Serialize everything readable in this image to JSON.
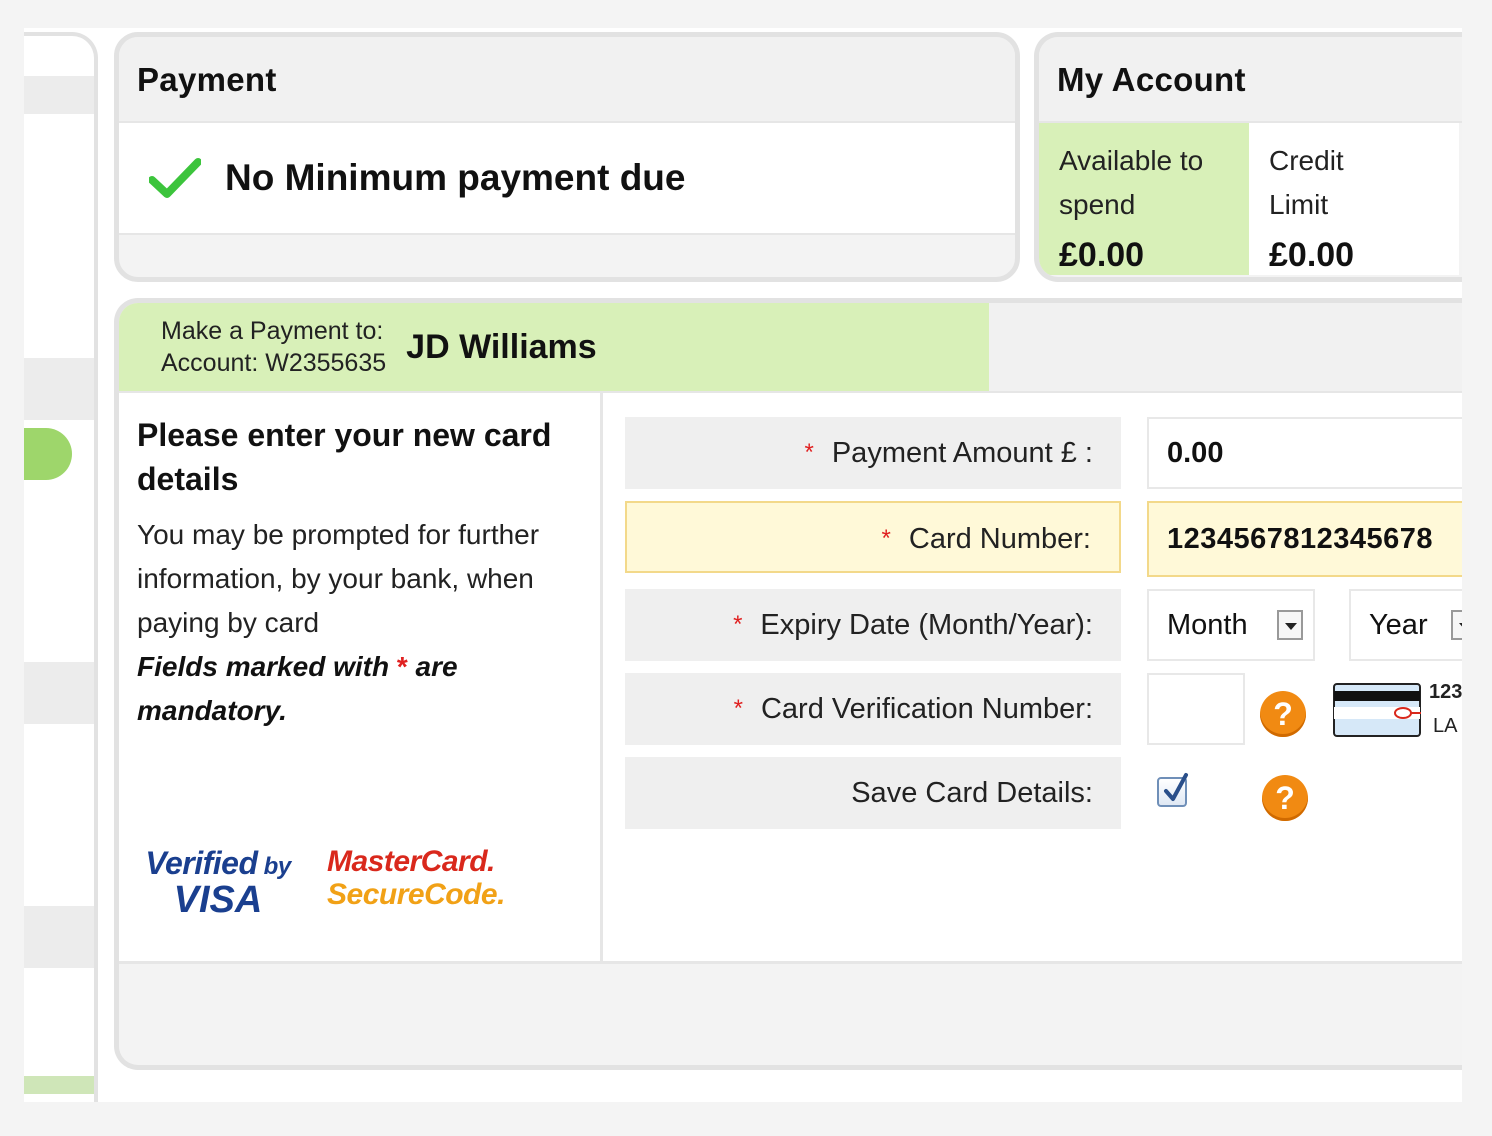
{
  "payment": {
    "title": "Payment",
    "status": "No Minimum payment due"
  },
  "account": {
    "title": "My Account",
    "available_label": "Available to spend",
    "available_value": "£0.00",
    "credit_label": "Credit Limit",
    "credit_value": "£0.00"
  },
  "merchant": {
    "make_payment_label": "Make a Payment to:",
    "account_label": "Account: W2355635",
    "name": "JD Williams"
  },
  "instructions": {
    "heading": "Please enter your new card details",
    "note": "You may be prompted for further information, by your bank, when paying by card",
    "mandatory_prefix": "Fields marked with",
    "mandatory_marker": "*",
    "mandatory_suffix": "are mandatory."
  },
  "form": {
    "required_marker": "*",
    "payment_amount_label": "Payment Amount £ :",
    "payment_amount_value": "0.00",
    "card_number_label": "Card Number:",
    "card_number_value": "1234567812345678",
    "expiry_label": "Expiry Date (Month/Year):",
    "expiry_month": "Month",
    "expiry_year": "Year",
    "cvv_label": "Card Verification Number:",
    "cvv_value": "",
    "cvv_card_digits": "123",
    "cvv_card_caption": "LA",
    "save_card_label": "Save Card Details:",
    "save_card_checked": true,
    "help_glyph": "?"
  },
  "logos": {
    "visa_line1": "Verified",
    "visa_by": "by",
    "visa_line2": "VISA",
    "mc_line1": "MasterCard.",
    "mc_line2": "SecureCode."
  },
  "colors": {
    "accent_green": "#d8f0b8",
    "check_green": "#3cc43c",
    "help_orange": "#f18a12",
    "required_red": "#e02020",
    "highlight_yellow": "#fff9d8"
  },
  "icons": [
    "checkmark-icon",
    "help-icon",
    "card-cvv-icon",
    "checkbox-checked-icon",
    "dropdown-arrow-icon"
  ]
}
